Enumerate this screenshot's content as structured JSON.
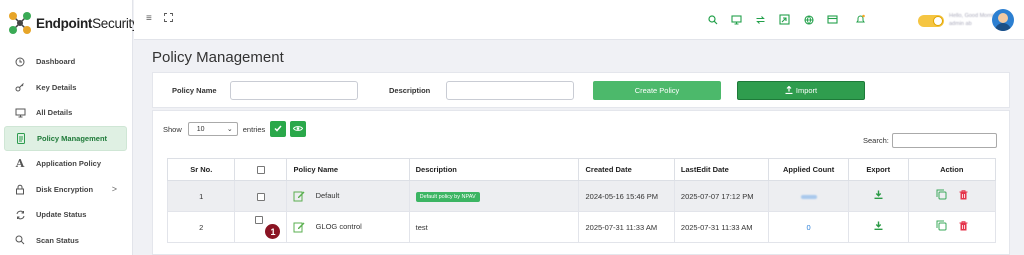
{
  "app": {
    "brand_bold": "Endpoint",
    "brand_rest": "Security"
  },
  "sidebar": {
    "items": [
      {
        "label": "Dashboard",
        "icon": "clock-icon"
      },
      {
        "label": "Key Details",
        "icon": "key-icon"
      },
      {
        "label": "All Details",
        "icon": "monitor-icon"
      },
      {
        "label": "Policy Management",
        "icon": "document-icon",
        "active": true
      },
      {
        "label": "Application Policy",
        "icon": "letter-a-icon"
      },
      {
        "label": "Disk Encryption",
        "icon": "lock-icon",
        "chevron": ">"
      },
      {
        "label": "Update Status",
        "icon": "refresh-icon"
      },
      {
        "label": "Scan Status",
        "icon": "search-icon"
      }
    ]
  },
  "topbar": {
    "greeting_blurred": "Hello, Good Morning",
    "user_blurred": "admin ab"
  },
  "main": {
    "title": "Policy Management",
    "filter": {
      "policy_name_label": "Policy Name",
      "policy_name_value": "",
      "description_label": "Description",
      "description_value": "",
      "create_button": "Create Policy",
      "import_button": "Import"
    },
    "list": {
      "show_label": "Show",
      "entries_value": "10",
      "entries_label": "entries",
      "search_label": "Search:",
      "search_value": "",
      "columns": [
        "Sr No.",
        "",
        "Policy Name",
        "Description",
        "Created Date",
        "LastEdit Date",
        "Applied Count",
        "Export",
        "Action"
      ],
      "rows": [
        {
          "sr": "1",
          "name": "Default",
          "description": "Default policy by NPAV",
          "description_badge": true,
          "created": "2024-05-16 15:46 PM",
          "edited": "2025-07-07 17:12 PM",
          "count": "",
          "count_blurred": true
        },
        {
          "sr": "2",
          "name": "GLOG control",
          "description": "test",
          "description_badge": false,
          "created": "2025-07-31 11:33 AM",
          "edited": "2025-07-31 11:33 AM",
          "count": "0",
          "count_blurred": false,
          "marker": "1"
        }
      ]
    }
  },
  "colors": {
    "accent_green": "#2f9d4e",
    "active_bg": "#dff0e3",
    "delete_red": "#e5344b",
    "marker": "#8a1423"
  }
}
